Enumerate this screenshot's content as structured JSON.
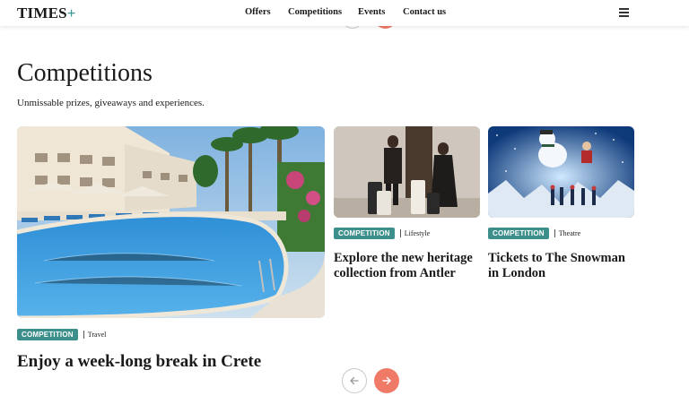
{
  "header": {
    "logo_text": "TIMES",
    "logo_plus": "+",
    "nav": [
      "Offers",
      "Competitions",
      "Events",
      "Contact us"
    ],
    "menu_icon": "hamburger-menu-icon"
  },
  "section": {
    "title": "Competitions",
    "subtitle": "Unmissable prizes, giveaways and experiences."
  },
  "cards": [
    {
      "badge": "COMPETITION",
      "category": "Travel",
      "headline": "Enjoy a week-long break in Crete",
      "image": "hotel-pool-crete"
    },
    {
      "badge": "COMPETITION",
      "category": "Lifestyle",
      "headline": "Explore the new heritage collection from Antler",
      "image": "luggage-models"
    },
    {
      "badge": "COMPETITION",
      "category": "Theatre",
      "headline": "Tickets to The Snowman in London",
      "image": "snowman-stage"
    }
  ],
  "carousel": {
    "prev_icon": "arrow-left-icon",
    "next_icon": "arrow-right-icon"
  },
  "colors": {
    "accent": "#3d8f8c",
    "arrow_active": "#f07a68"
  }
}
